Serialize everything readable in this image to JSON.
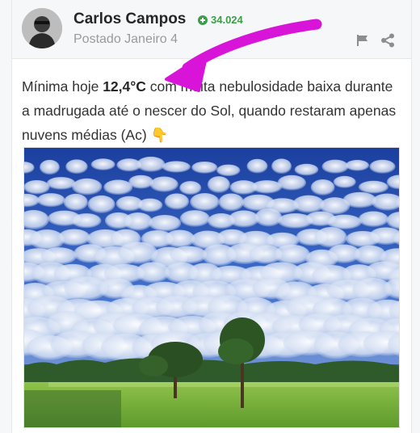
{
  "author": {
    "name": "Carlos Campos",
    "reputation": "34.024"
  },
  "post": {
    "posted": "Postado Janeiro 4",
    "text_before": "Mínima hoje ",
    "text_bold": "12,4°C",
    "text_after": " com muita nebulosidade baixa durante a madrugada até o nescer do Sol, quando restaram apenas nuvens médias (Ac) 👇"
  },
  "icons": {
    "flag": "flag-icon",
    "share": "share-icon",
    "reputation": "plus-circle-icon"
  },
  "colors": {
    "annotation_arrow": "#d914d9",
    "reputation": "#3f9c4b"
  }
}
